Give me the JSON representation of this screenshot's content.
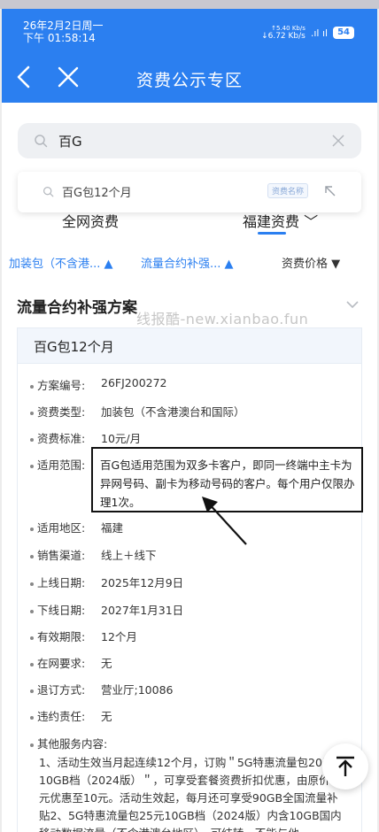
{
  "status_bar": {
    "date": "26年2月2日周一",
    "time": "下午 01:58:14",
    "speed_up": "↑5.40 Kb/s",
    "speed_down": "↓6.72 Kb/s",
    "signal": ".ıl ıl",
    "battery": "54"
  },
  "nav": {
    "title": "资费公示专区"
  },
  "search": {
    "value": "百G"
  },
  "suggestion": {
    "text": "百G包12个月",
    "badge": "资费名称"
  },
  "tabs": [
    {
      "label": "全网资费"
    },
    {
      "label": "福建资费 ﹀"
    }
  ],
  "filters": [
    {
      "label": "加装包（不含港... ▲"
    },
    {
      "label": "流量合约补强... ▲"
    },
    {
      "label": "资费价格 ▼"
    }
  ],
  "section": {
    "title": "流量合约补强方案",
    "watermark": "线报酷-new.xianbao.fun"
  },
  "plan": {
    "name": "百G包12个月",
    "fields": [
      {
        "label": "方案编号:",
        "value": "26FJ200272"
      },
      {
        "label": "资费类型:",
        "value": "加装包（不含港澳台和国际）"
      },
      {
        "label": "资费标准:",
        "value": "10元/月"
      },
      {
        "label": "适用范围:",
        "value": "百G包适用范围为双多卡客户，即同一终端中主卡为异网号码、副卡为移动号码的客户。每个用户仅限办理1次。"
      },
      {
        "label": "适用地区:",
        "value": "福建"
      },
      {
        "label": "销售渠道:",
        "value": "线上＋线下"
      },
      {
        "label": "上线日期:",
        "value": "2025年12月9日"
      },
      {
        "label": "下线日期:",
        "value": "2027年1月31日"
      },
      {
        "label": "有效期限:",
        "value": "12个月"
      },
      {
        "label": "在网要求:",
        "value": "无"
      },
      {
        "label": "退订方式:",
        "value": "营业厅;10086"
      },
      {
        "label": "违约责任:",
        "value": "无"
      },
      {
        "label": "其他服务内容:",
        "value": "1、活动生效当月起连续12个月，订购＂5G特惠流量包20元10GB档（2024版）＂，可享受套餐资费折扣优惠，由原价20元优惠至10元。活动生效起，每月还可享受90GB全国流量补贴2、5G特惠流量包25元10GB档（2024版）内含10GB国内移动数据流量（不含港澳台地区），可结转，不能与他"
      }
    ]
  },
  "colors": {
    "primary": "#2b7ff0",
    "background": "#ececec"
  }
}
